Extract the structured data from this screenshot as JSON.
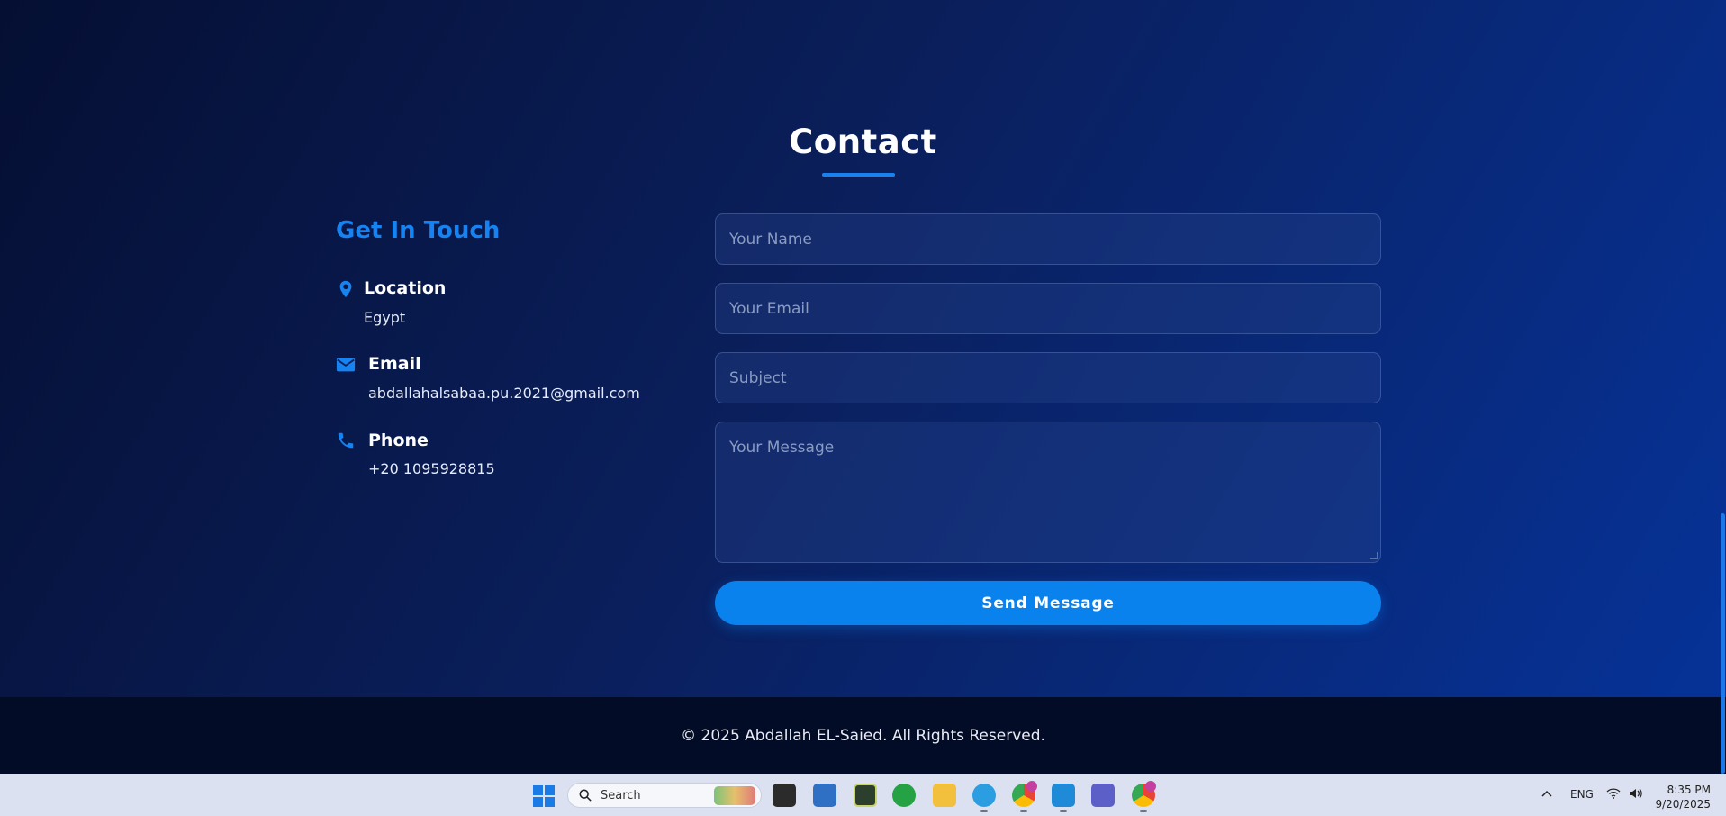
{
  "section": {
    "title": "Contact"
  },
  "contact_info": {
    "heading": "Get In Touch",
    "items": [
      {
        "icon": "location-pin-icon",
        "label": "Location",
        "value": "Egypt"
      },
      {
        "icon": "envelope-icon",
        "label": "Email",
        "value": "abdallahalsabaa.pu.2021@gmail.com"
      },
      {
        "icon": "phone-icon",
        "label": "Phone",
        "value": "+20 1095928815"
      }
    ]
  },
  "form": {
    "name_placeholder": "Your Name",
    "email_placeholder": "Your Email",
    "subject_placeholder": "Subject",
    "message_placeholder": "Your Message",
    "submit_label": "Send Message"
  },
  "footer": {
    "text": "© 2025 Abdallah EL-Saied. All Rights Reserved."
  },
  "taskbar": {
    "search_label": "Search",
    "language": "ENG",
    "time": "8:35 PM",
    "date": "9/20/2025",
    "apps": [
      "file-explorer-dark-icon",
      "photos-icon",
      "calculator-icon",
      "whatsapp-icon",
      "folder-icon",
      "telegram-icon",
      "chrome-icon",
      "vscode-icon",
      "teams-icon",
      "chrome-dev-icon"
    ]
  },
  "colors": {
    "accent": "#0a82ee",
    "heading_accent": "#1683f0",
    "footer_bg": "#030c26",
    "taskbar_bg": "#dbe1f0"
  }
}
